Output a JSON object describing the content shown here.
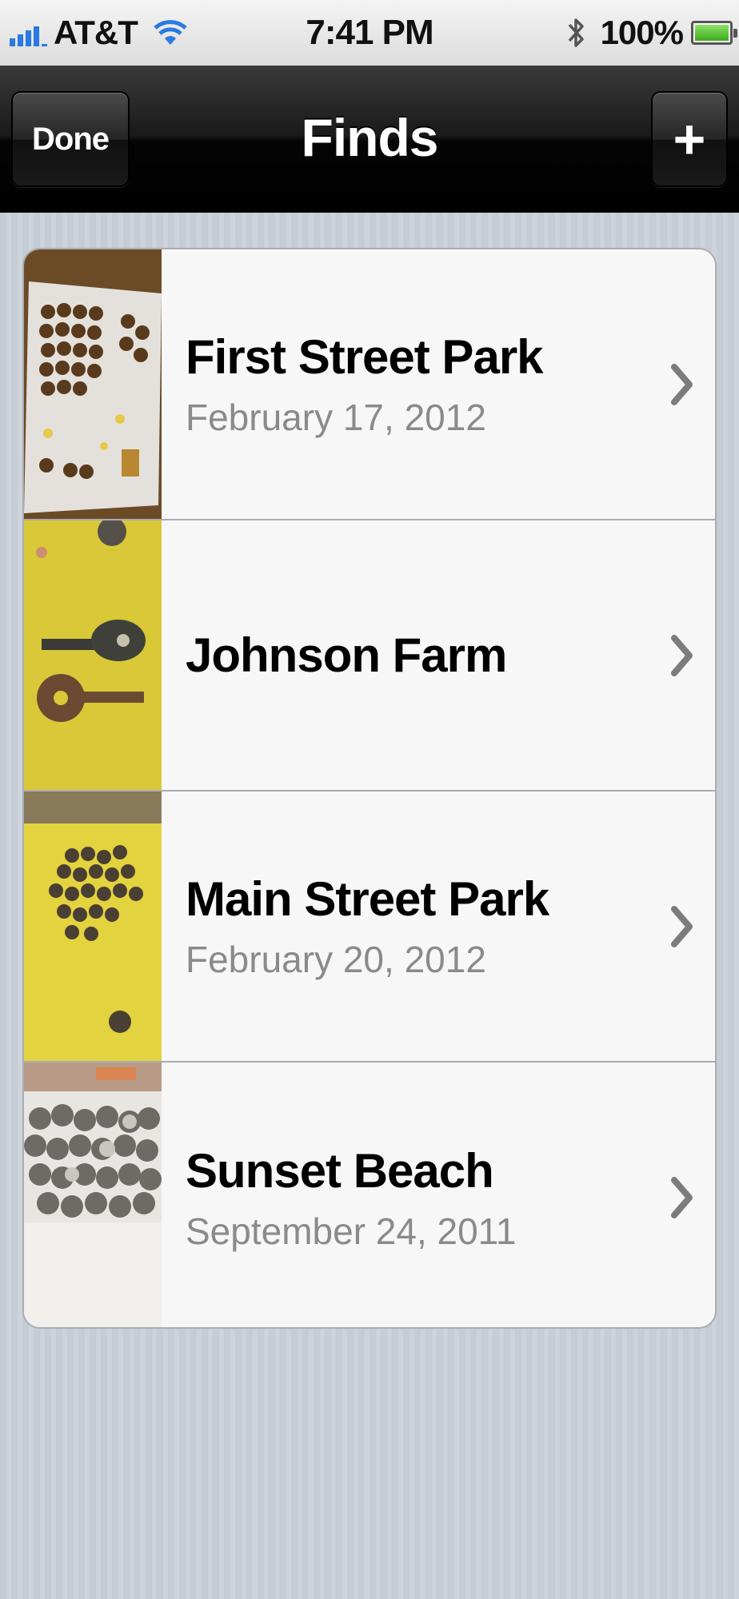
{
  "status_bar": {
    "carrier": "AT&T",
    "time": "7:41 PM",
    "battery": "100%",
    "battery_level": 1.0,
    "signal_bars": 5
  },
  "nav": {
    "title": "Finds",
    "done_label": "Done",
    "add_label": "+"
  },
  "finds": [
    {
      "title": "First Street Park",
      "date": "February 17, 2012",
      "thumbnail": "coins-on-paper"
    },
    {
      "title": "Johnson Farm",
      "date": "",
      "thumbnail": "keys-on-towel"
    },
    {
      "title": "Main Street Park",
      "date": "February 20, 2012",
      "thumbnail": "coins-on-towel"
    },
    {
      "title": "Sunset Beach",
      "date": "September 24, 2011",
      "thumbnail": "coins-in-bag"
    }
  ],
  "colors": {
    "accent_blue": "#2a7ae2",
    "battery_green": "#4cc628",
    "nav_bar": "#1a1a1a",
    "background": "#c5ccd4",
    "subtitle_gray": "#8a8a8a"
  }
}
